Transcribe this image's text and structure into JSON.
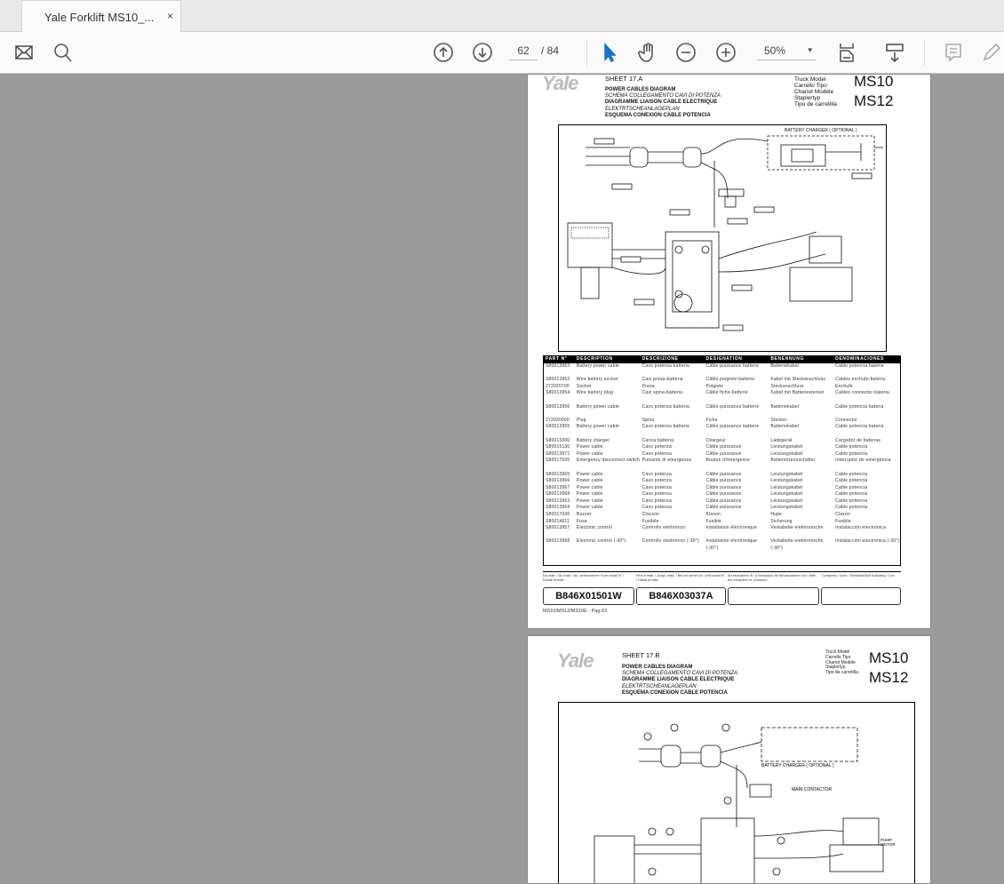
{
  "tab": {
    "title": "Yale Forklift MS10_...",
    "close": "×"
  },
  "toolbar": {
    "page_current": "62",
    "page_total": "/ 84",
    "zoom": "50%",
    "zoom_caret": "▾",
    "icons": [
      "mail-icon",
      "search-icon",
      "page-up-icon",
      "page-down-icon",
      "select-cursor-icon",
      "hand-icon",
      "zoom-out-icon",
      "zoom-in-icon",
      "fit-page-icon",
      "scroll-mode-icon",
      "comment-icon",
      "pen-icon"
    ]
  },
  "colors": {
    "cursor_accent": "#1a73c9",
    "viewer_bg": "#9b9b9b"
  },
  "page1": {
    "logo": "Yale",
    "sheet": "SHEET  17.A",
    "titles": [
      "POWER CABLES DIAGRAM",
      "SCHEMA COLLEGAMENTO CAVI DI POTENZA",
      "DIAGRAMME LIAISON CABLE ELECTRIQUE",
      "ELEKTRTSCHEANLAGEPLAN",
      "ESQUEMA CONEXION CABLE POTENCIA"
    ],
    "model_labels": [
      "Truck Model",
      "Carrello Tipo",
      "Chariot Modele",
      "Staplertyp",
      "Tipo de carretilla"
    ],
    "models": [
      "MS10",
      "MS12"
    ],
    "diagram_label": "BATTERY CHARGER ( OPTIONAL )",
    "table": {
      "headers": [
        "PART N°",
        "DESCRIPTION",
        "DESCRIZIONE",
        "DESIGNATION",
        "BENENNUNG",
        "DENOMINACIONES"
      ],
      "rows": [
        {
          "c": [
            "S80013953",
            "Battery power cable",
            "Cavo potenza batteria",
            "Câble puissance batterie",
            "Batteriekabel",
            "Cable potencia bateria"
          ]
        },
        {
          "gap": true,
          "c": [
            "S80013952",
            "Wire battery socket",
            "Cavi presa-batteria",
            "Câble poignée-batterie",
            "Kabel mit Steckanschluss",
            "Cables enchufe-bateria"
          ]
        },
        {
          "c": [
            "272020700",
            "Socket",
            "Presa",
            "Poignée",
            "Steckanschluss",
            "Enchufe"
          ]
        },
        {
          "c": [
            "S80013954",
            "Wire battery plug",
            "Cavi spina-batteria",
            "Câble fiche-batterie",
            "Kabel mit Batteriestecker",
            "Cables connector-bateria"
          ]
        },
        {
          "gap": true,
          "c": [
            "S80013956",
            "Battery power cable",
            "Cavo potenza batteria",
            "Câble puissance batterie",
            "Batteriekabel",
            "Cable potencia bateria"
          ]
        },
        {
          "gap": true,
          "c": [
            "272020600",
            "Plug",
            "Spina",
            "Fiche",
            "Stecker",
            "Connector"
          ]
        },
        {
          "c": [
            "S80013955",
            "Battery power cable",
            "Cavo potenza batteria",
            "Câble puissance batterie",
            "Batteriekabel",
            "Cable potencia bateria"
          ]
        },
        {
          "gap": true,
          "c": [
            "S80013300",
            "Battery charger",
            "Carica batteria",
            "Chargeur",
            "Ladegerät",
            "Cargador de baterias"
          ]
        },
        {
          "c": [
            "S80015130",
            "Power cable",
            "Cavo potenza",
            "Câble puissance",
            "Leistungskabel",
            "Cable potencia"
          ]
        },
        {
          "c": [
            "S80013971",
            "Power cable",
            "Cavo potenza",
            "Câble puissance",
            "Leistungskabel",
            "Cable potencia"
          ]
        },
        {
          "tall": true,
          "c": [
            "S80017035",
            "Emergency disconnect switch",
            "Pulsante di emergenza",
            "Bouton d'émergence",
            "Batterietrennschalter",
            "Interruptor de emergencia"
          ]
        },
        {
          "c": [
            "S80013965",
            "Power cable",
            "Cavo potenza",
            "Câble puissance",
            "Leistungskabel",
            "Cable potencia"
          ]
        },
        {
          "c": [
            "S80013966",
            "Power cable",
            "Cavo potenza",
            "Câble puissance",
            "Leistungskabel",
            "Cable potencia"
          ]
        },
        {
          "c": [
            "S80013967",
            "Power cable",
            "Cavo potenza",
            "Câble puissance",
            "Leistungskabel",
            "Cable potencia"
          ]
        },
        {
          "c": [
            "S80013968",
            "Power cable",
            "Cavo potenza",
            "Câble puissance",
            "Leistungskabel",
            "Cable potencia"
          ]
        },
        {
          "c": [
            "S80013963",
            "Power cable",
            "Cavo potenza",
            "Câble puissance",
            "Leistungskabel",
            "Cable potencia"
          ]
        },
        {
          "c": [
            "S80013964",
            "Power cable",
            "Cavo potenza",
            "Câble puissance",
            "Leistungskabel",
            "Cable potencia"
          ]
        },
        {
          "c": [
            "S80017036",
            "Buzzer",
            "Clacson",
            "Klaxon",
            "Hupe",
            "Claxon"
          ]
        },
        {
          "c": [
            "S80014611",
            "Fuse",
            "Fusibile",
            "Fusible",
            "Sicherung",
            "Fusible"
          ]
        },
        {
          "c": [
            "S80013957",
            "Electonic control",
            "Controllo elettronico",
            "Installation électronique",
            "Verkabelte elektronische",
            "Instalacción electronica"
          ]
        },
        {
          "gap": true,
          "tall": true,
          "c": [
            "S80013958",
            "Electonic control (-30°)",
            "Controllo elettronico (-30°)",
            "Installation électronique (-30°)",
            "Verkabelte elektronische (-30°)",
            "Instalacción electronica (-30°)"
          ]
        }
      ]
    },
    "footer": {
      "labels": [
        "Da matr. / Du matr. / Ab. serienummer From serial N° / Desde la matr.:",
        "Fino a matr. / Jusqu' matr. / Bis zur serien-Nr. Until serial N° / Hasta la matr.:",
        "Ad esclusione di / A l'exclusion de Mit ausnahme von / With the exception of / Excepto:",
        "Compreso / Avec / Einschließlich Including / Con:"
      ],
      "values": [
        "B846X01501W",
        "B846X03037A",
        "",
        ""
      ],
      "page_ref": "MS10/MS12/MS10E - Pag.62"
    }
  },
  "page2": {
    "logo": "Yale",
    "sheet": "SHEET  17.B",
    "titles": [
      "POWER CABLES DIAGRAM",
      "SCHEMA COLLEGAMENTO CAVI DI POTENZA",
      "DIAGRAMME LIAISON CABLE ELECTRIQUE",
      "ELEKTRTSCHEANLAGEPLAN",
      "ESQUEMA CONEXION CABLE POTENCIA"
    ],
    "model_labels": [
      "Truck Model",
      "Carrello Tipo",
      "Chariot Modele",
      "Staplertyp",
      "Tipo de carretilla"
    ],
    "models": [
      "MS10",
      "MS12"
    ],
    "diagram_labels": [
      "BATTERY CHARGER ( OPTIONAL )",
      "MAIN CONTACTOR",
      "PUMP MOTOR"
    ]
  }
}
